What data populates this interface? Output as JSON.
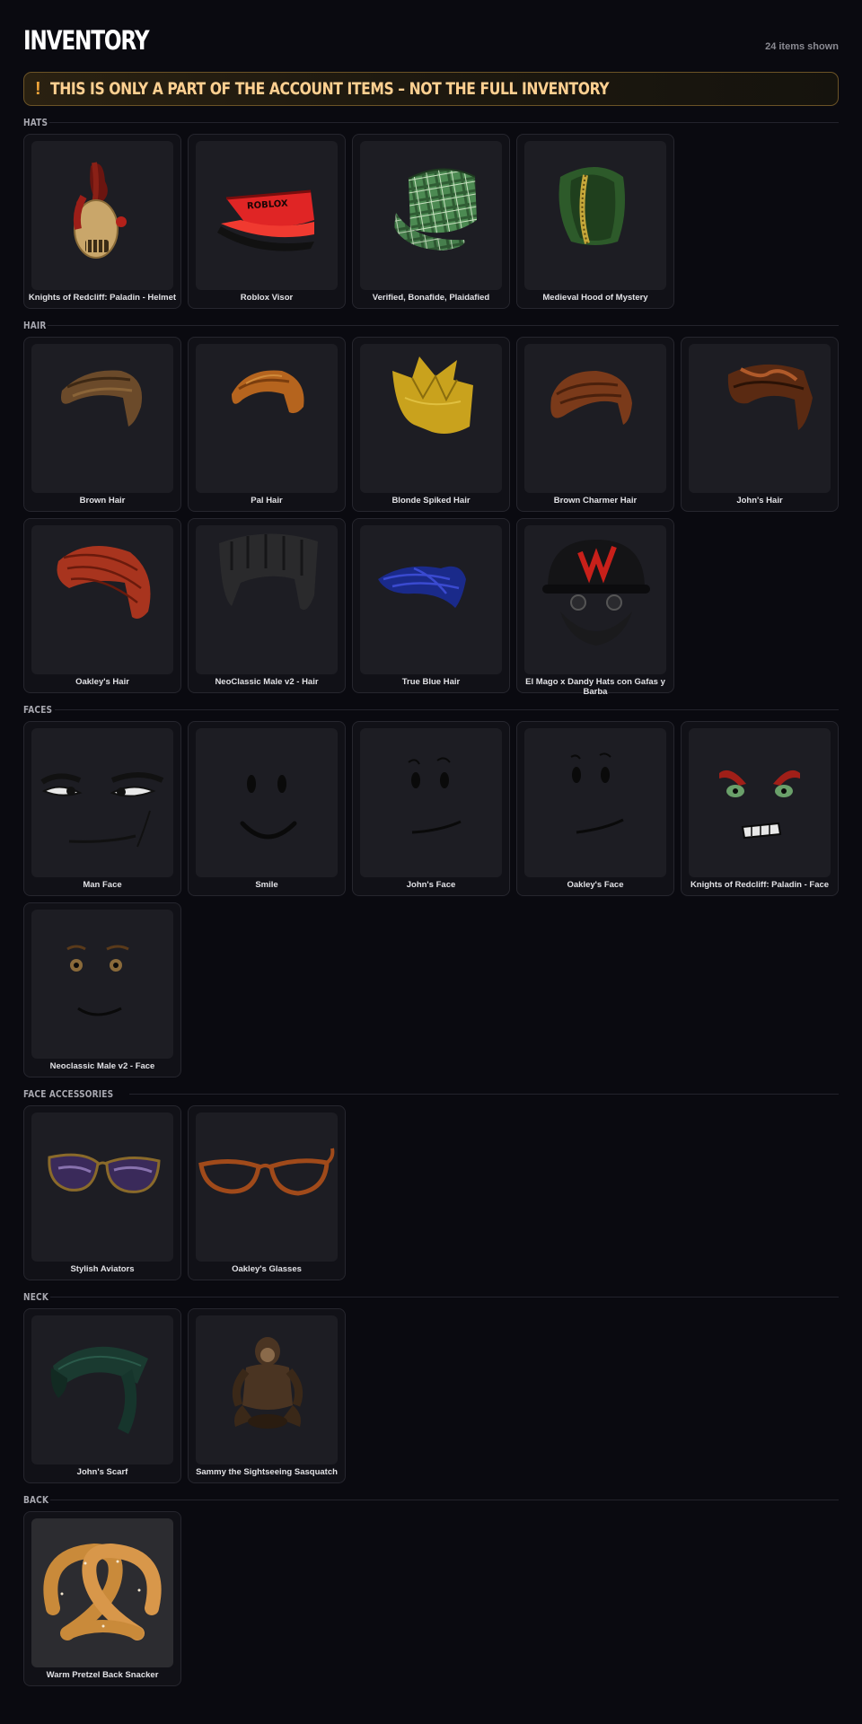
{
  "header": {
    "title": "INVENTORY",
    "count": "24 items shown"
  },
  "banner": {
    "icon": "!",
    "text": "THIS IS ONLY A PART OF THE ACCOUNT ITEMS – NOT THE FULL INVENTORY"
  },
  "sections": [
    {
      "label": "HATS",
      "items": [
        {
          "name": "Knights of Redcliff: Paladin - Helmet",
          "icon": "helmet-icon"
        },
        {
          "name": "Roblox Visor",
          "icon": "visor-icon"
        },
        {
          "name": "Verified, Bonafide, Plaidafied",
          "icon": "plaid-cap-icon"
        },
        {
          "name": "Medieval Hood of Mystery",
          "icon": "hood-icon"
        }
      ]
    },
    {
      "label": "HAIR",
      "items": [
        {
          "name": "Brown Hair",
          "icon": "hair-icon"
        },
        {
          "name": "Pal Hair",
          "icon": "hair-icon"
        },
        {
          "name": "Blonde Spiked Hair",
          "icon": "hair-icon"
        },
        {
          "name": "Brown Charmer Hair",
          "icon": "hair-icon"
        },
        {
          "name": "John's Hair",
          "icon": "hair-icon"
        },
        {
          "name": "Oakley's Hair",
          "icon": "hair-icon"
        },
        {
          "name": "NeoClassic Male v2 - Hair",
          "icon": "hair-icon"
        },
        {
          "name": "True Blue Hair",
          "icon": "hair-icon"
        },
        {
          "name": "El Mago x Dandy Hats con Gafas y Barba",
          "icon": "cap-glasses-beard-icon"
        }
      ]
    },
    {
      "label": "FACES",
      "items": [
        {
          "name": "Man Face",
          "icon": "face-icon"
        },
        {
          "name": "Smile",
          "icon": "face-icon"
        },
        {
          "name": "John's Face",
          "icon": "face-icon"
        },
        {
          "name": "Oakley's Face",
          "icon": "face-icon"
        },
        {
          "name": "Knights of Redcliff: Paladin - Face",
          "icon": "face-icon"
        },
        {
          "name": "Neoclassic Male v2 - Face",
          "icon": "face-icon"
        }
      ]
    },
    {
      "label": "FACE ACCESSORIES",
      "items": [
        {
          "name": "Stylish Aviators",
          "icon": "glasses-icon"
        },
        {
          "name": "Oakley's Glasses",
          "icon": "glasses-icon"
        }
      ]
    },
    {
      "label": "NECK",
      "items": [
        {
          "name": "John's Scarf",
          "icon": "scarf-icon"
        },
        {
          "name": "Sammy the Sightseeing Sasquatch",
          "icon": "sasquatch-icon"
        }
      ]
    },
    {
      "label": "BACK",
      "items": [
        {
          "name": "Warm Pretzel Back Snacker",
          "icon": "pretzel-icon"
        }
      ]
    }
  ]
}
